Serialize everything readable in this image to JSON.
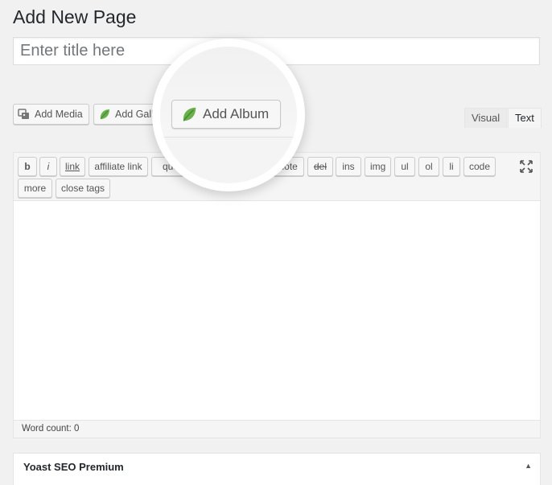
{
  "page": {
    "title": "Add New Page"
  },
  "title_field": {
    "placeholder": "Enter title here",
    "value": ""
  },
  "media_buttons": {
    "add_media": "Add Media",
    "add_gallery": "Add Gallery",
    "add_album": "Add Album"
  },
  "editor_tabs": {
    "visual": "Visual",
    "text": "Text",
    "active": "text"
  },
  "quicktags": {
    "row1": [
      "b",
      "i",
      "link",
      "affiliate link",
      "quote",
      "b-quote",
      "del",
      "ins",
      "img",
      "ul",
      "ol",
      "li",
      "code"
    ],
    "row2": [
      "more",
      "close tags"
    ]
  },
  "editor": {
    "content": "",
    "word_count": "Word count: 0"
  },
  "metabox": {
    "title": "Yoast SEO Premium",
    "toggle": "▲"
  },
  "icons": {
    "media": "media-icon",
    "leaf": "leaf-icon",
    "fullscreen": "fullscreen-icon"
  },
  "colors": {
    "leaf": "#6ab04c",
    "leaf_dark": "#3f8a2f",
    "background": "#f1f1f1"
  }
}
